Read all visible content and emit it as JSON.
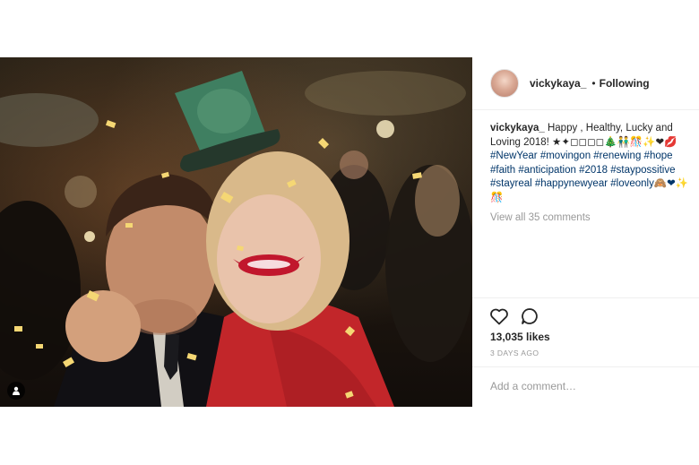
{
  "post": {
    "username": "vickykaya_",
    "separator": "•",
    "follow_status": "Following",
    "caption": {
      "username": "vickykaya_",
      "text": "Happy , Healthy, Lucky and Loving 2018! ★✦◻◻◻◻🎄👬🎊✨❤💋",
      "hashtags": "#NewYear #movingon #renewing #hope #faith #anticipation #2018 #staypossitive #stayreal #happynewyear #loveonly🙈❤✨🎊"
    },
    "view_all_comments": "View all 35 comments",
    "likes": "13,035 likes",
    "time_ago": "3 DAYS AGO",
    "comment_placeholder": "Add a comment…"
  },
  "icons": {
    "like": "heart-icon",
    "comment": "comment-bubble-icon",
    "tagged": "person-tag-icon"
  },
  "colors": {
    "hashtag": "#003569",
    "muted": "#999999",
    "text": "#262626",
    "border": "#efefef"
  }
}
